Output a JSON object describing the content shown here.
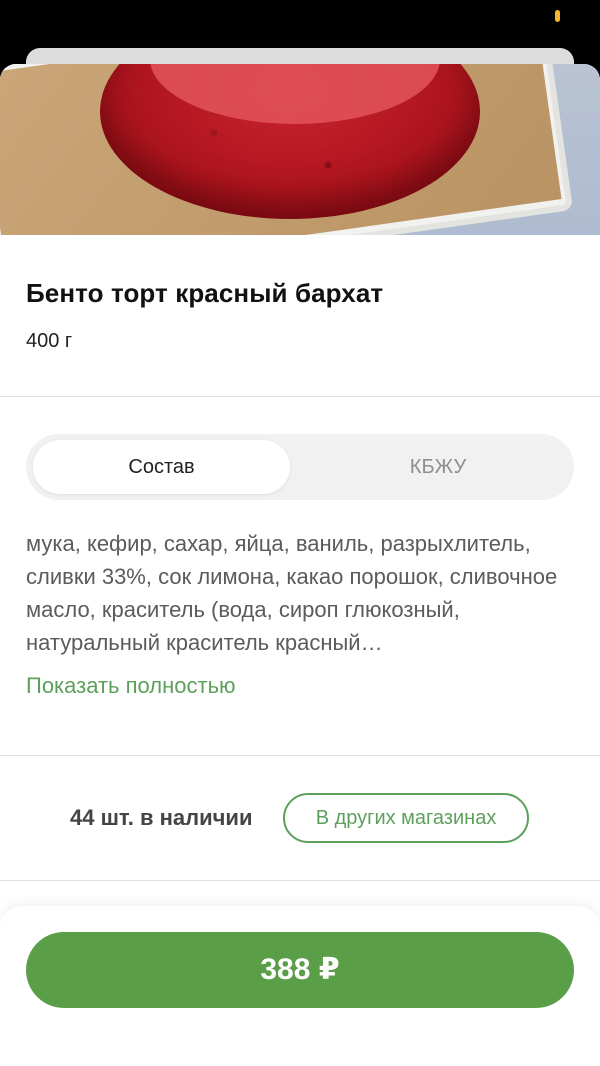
{
  "product": {
    "title": "Бенто торт красный бархат",
    "weight": "400 г"
  },
  "tabs": [
    {
      "label": "Состав",
      "active": true
    },
    {
      "label": "КБЖУ",
      "active": false
    }
  ],
  "ingredients": {
    "text": "мука, кефир, сахар, яйца, ваниль, разрыхлитель, сливки 33%, сок лимона, какао порошок, сливочное масло, краситель (вода, сироп глюкозный, натуральный краситель красный…",
    "show_more_label": "Показать полностью"
  },
  "stock": {
    "text": "44 шт. в наличии",
    "other_stores_label": "В других магазинах"
  },
  "purchase": {
    "price_label": "388 ₽"
  },
  "colors": {
    "accent_green": "#5b9e48",
    "link_green": "#5da05b"
  }
}
